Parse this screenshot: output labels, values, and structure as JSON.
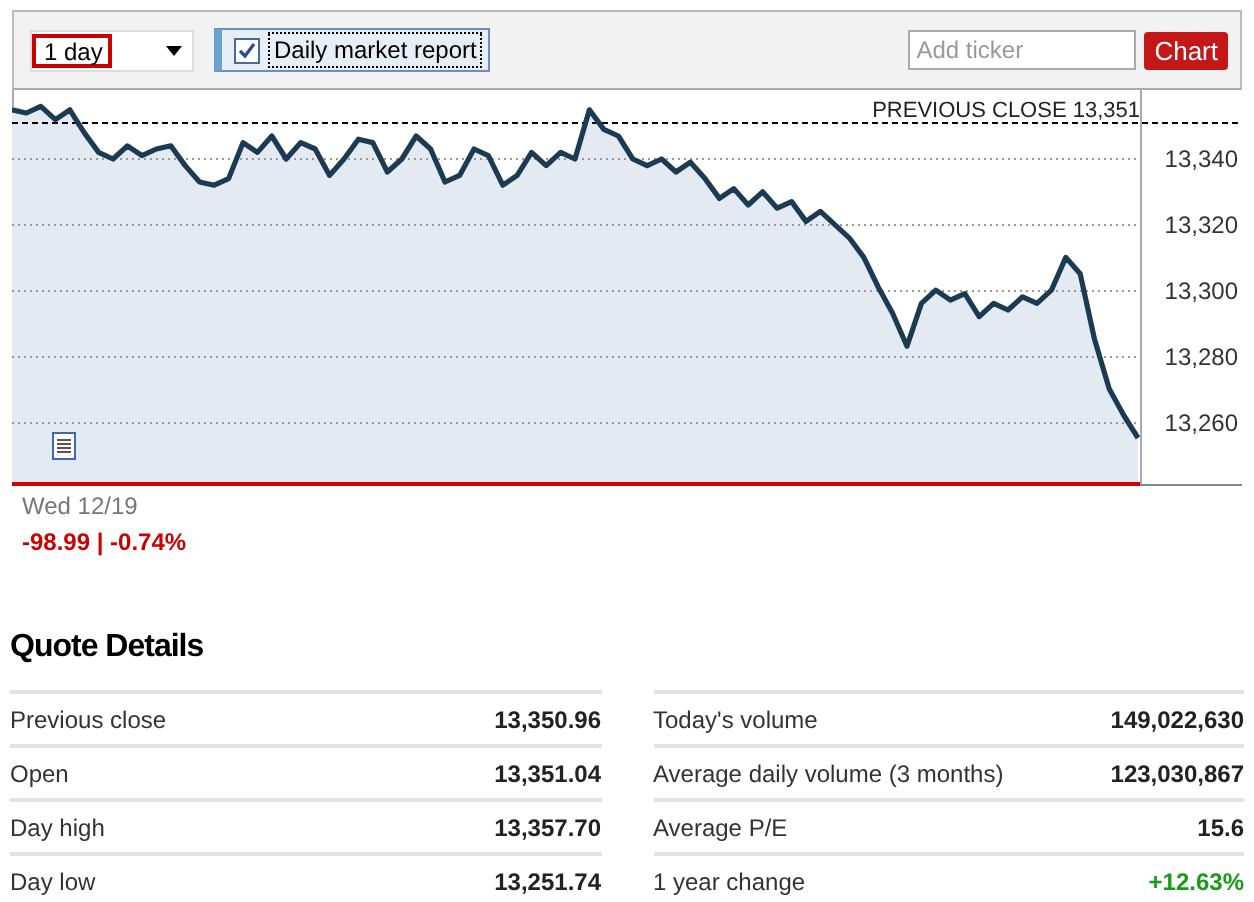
{
  "toolbar": {
    "range": {
      "value": "1 day"
    },
    "report_checkbox": {
      "label": "Daily market report",
      "checked": true
    },
    "ticker_field": {
      "placeholder": "Add ticker"
    },
    "chart_button": "Chart"
  },
  "chart": {
    "chart_data": {
      "type": "area",
      "ylim": [
        13241,
        13361
      ],
      "values": [
        13355,
        13354,
        13356,
        13352,
        13355,
        13348,
        13342,
        13340,
        13344,
        13341,
        13343,
        13344,
        13338,
        13333,
        13332,
        13334,
        13345,
        13342,
        13347,
        13340,
        13345,
        13343,
        13335,
        13340,
        13346,
        13345,
        13336,
        13340,
        13347,
        13343,
        13333,
        13335,
        13343,
        13341,
        13332,
        13335,
        13342,
        13338,
        13342,
        13340,
        13355,
        13349,
        13347,
        13340,
        13338,
        13340,
        13336,
        13339,
        13334,
        13328,
        13331,
        13326,
        13330,
        13325,
        13327,
        13321,
        13324,
        13320,
        13316,
        13310,
        13301,
        13293,
        13283,
        13296,
        13300,
        13297,
        13299,
        13292,
        13296,
        13294,
        13298,
        13296,
        13300,
        13310,
        13305,
        13285,
        13270,
        13262,
        13255
      ],
      "yticks": [
        {
          "value": 13340,
          "label": "13,340"
        },
        {
          "value": 13320,
          "label": "13,320"
        },
        {
          "value": 13300,
          "label": "13,300"
        },
        {
          "value": 13280,
          "label": "13,280"
        },
        {
          "value": 13260,
          "label": "13,260"
        }
      ],
      "grid": true,
      "ref_lines": [
        {
          "axis": "y",
          "value": 13351,
          "label": "PREVIOUS CLOSE 13,351"
        }
      ]
    },
    "date": "Wed 12/19",
    "change": {
      "text": "-98.99 | -0.74%",
      "kind": "loss"
    }
  },
  "quote_details": {
    "title": "Quote Details",
    "columns": [
      [
        {
          "label": "Previous close",
          "value": "13,350.96",
          "kind": "plain"
        },
        {
          "label": "Open",
          "value": "13,351.04",
          "kind": "plain"
        },
        {
          "label": "Day high",
          "value": "13,357.70",
          "kind": "plain"
        },
        {
          "label": "Day low",
          "value": "13,251.74",
          "kind": "plain"
        }
      ],
      [
        {
          "label": "Today's volume",
          "value": "149,022,630",
          "kind": "plain"
        },
        {
          "label": "Average daily volume (3 months)",
          "value": "123,030,867",
          "kind": "plain"
        },
        {
          "label": "Average P/E",
          "value": "15.6",
          "kind": "plain"
        },
        {
          "label": "1 year change",
          "value": "+12.63%",
          "kind": "gain"
        }
      ]
    ]
  }
}
